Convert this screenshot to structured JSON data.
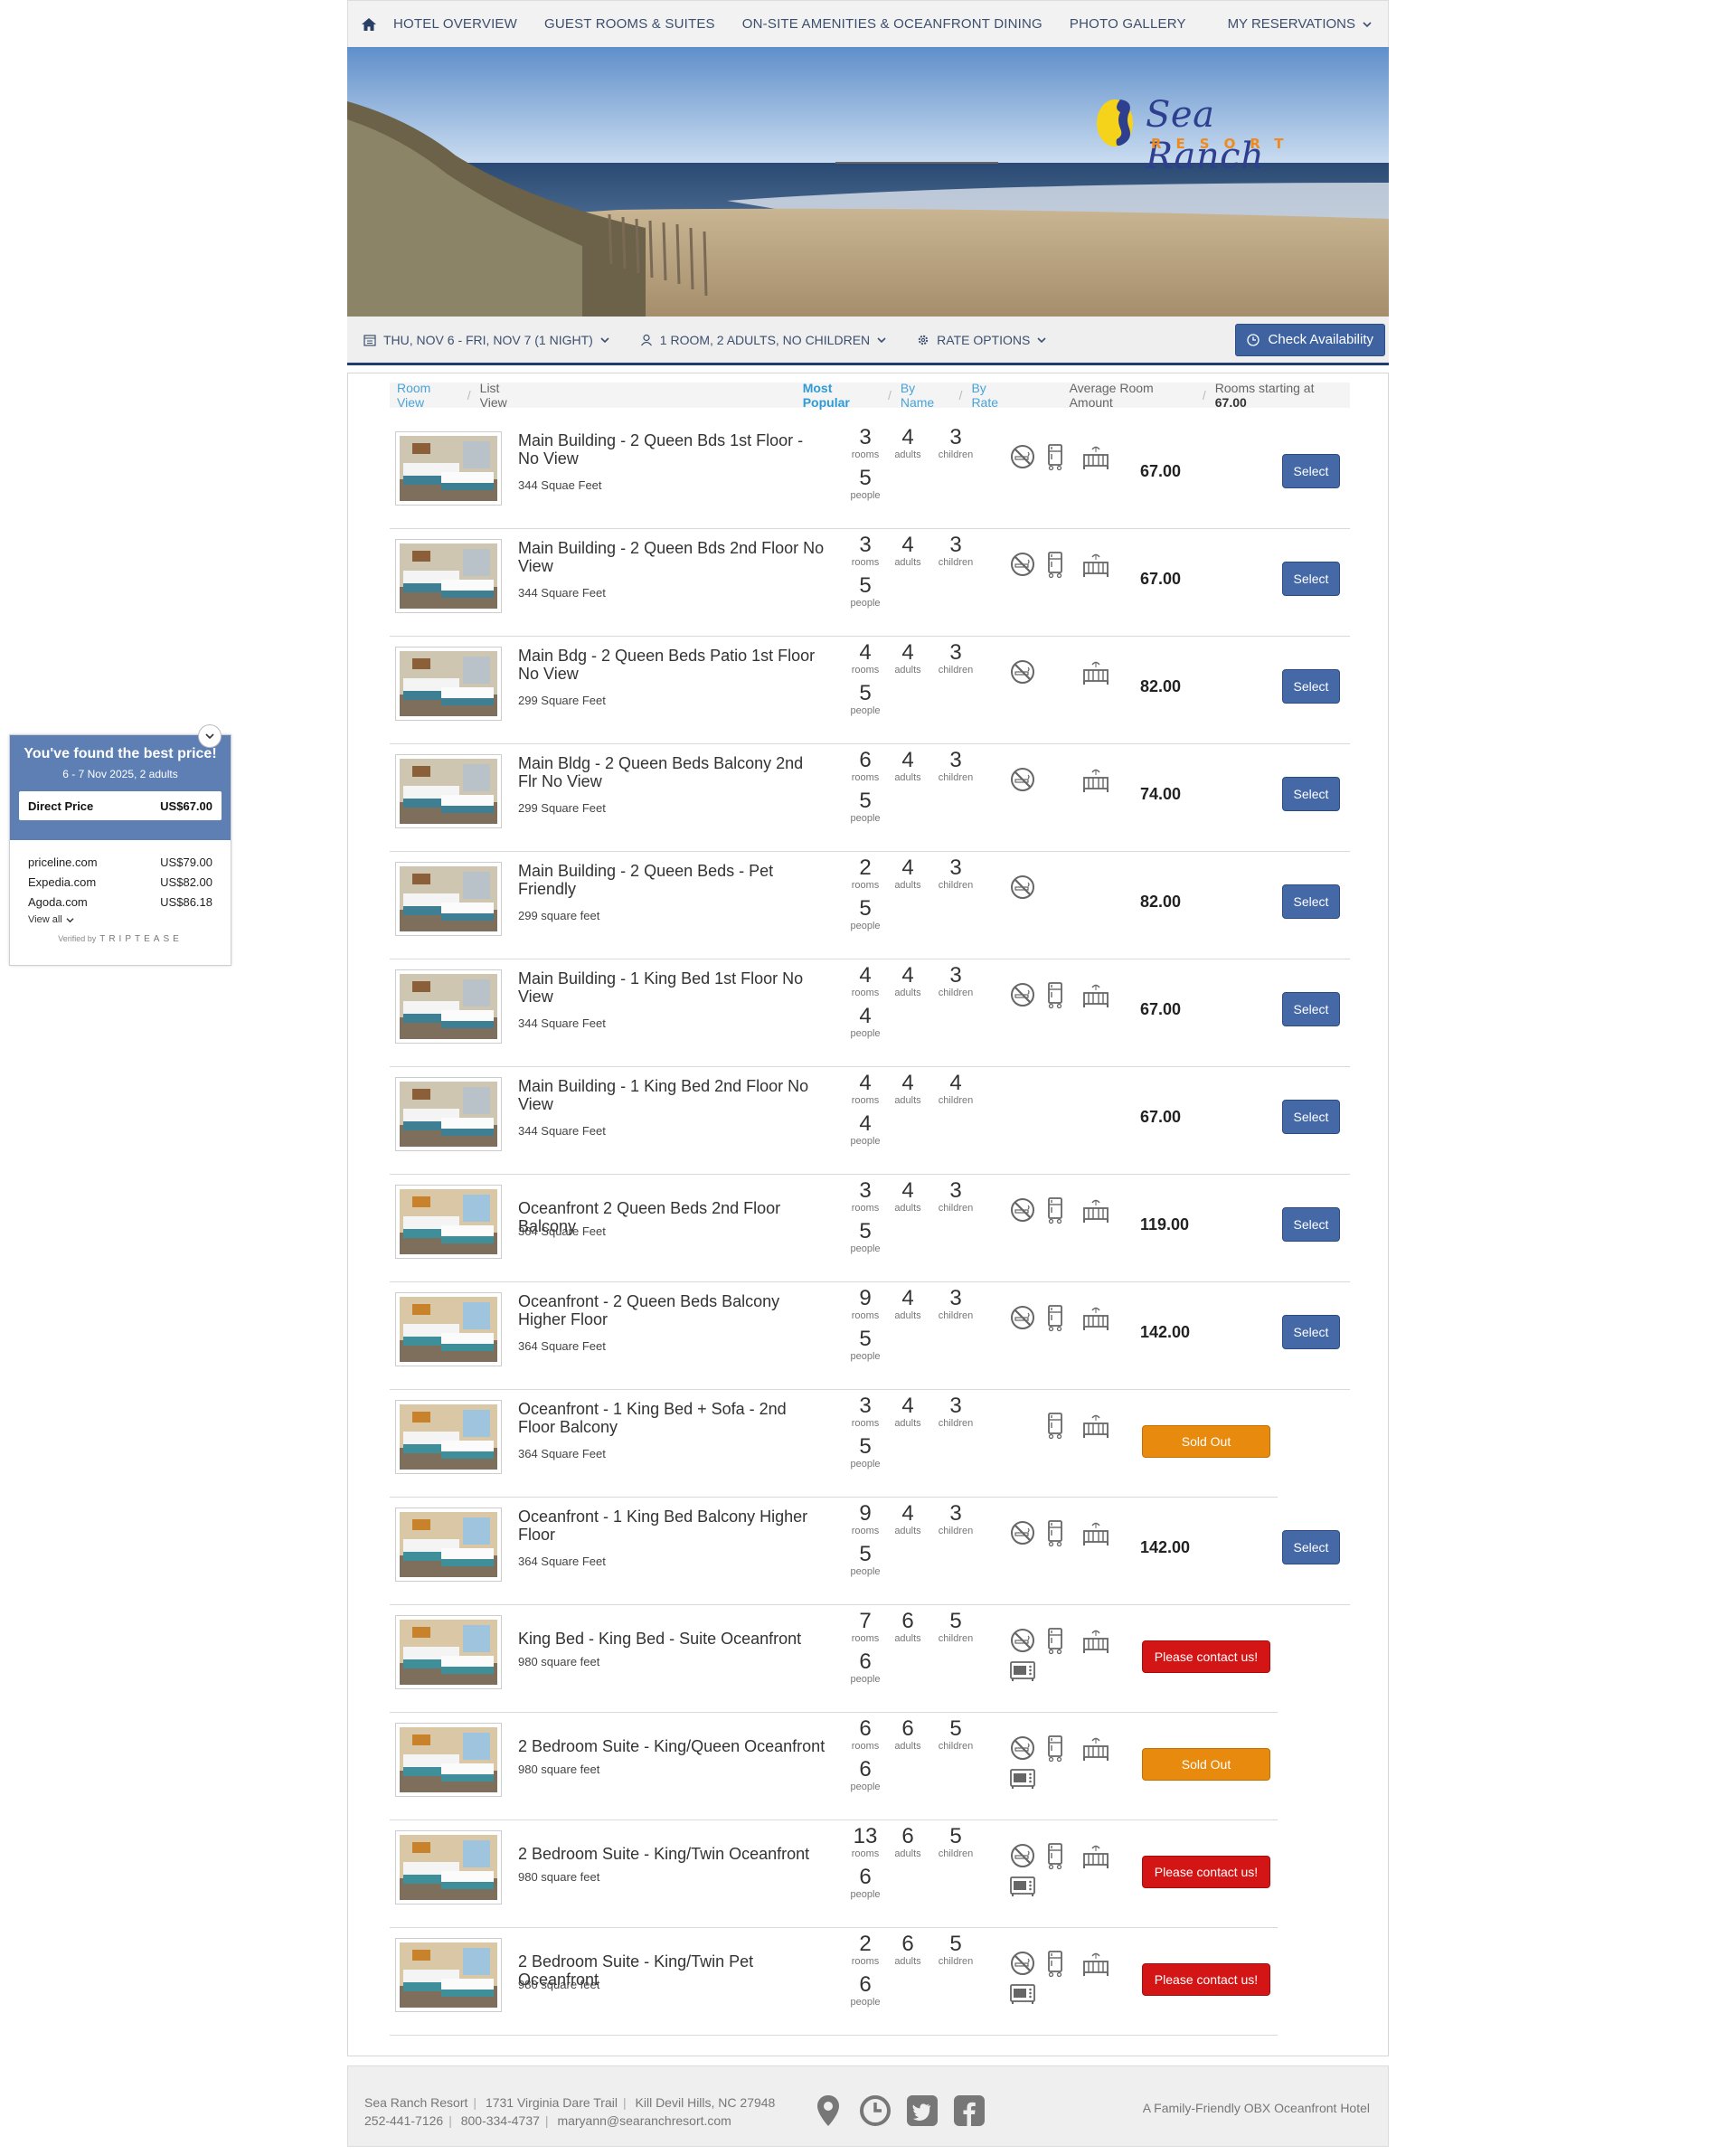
{
  "nav": {
    "items": [
      "HOTEL OVERVIEW",
      "GUEST ROOMS & SUITES",
      "ON-SITE AMENITIES & OCEANFRONT DINING",
      "PHOTO GALLERY"
    ],
    "reservations": "MY RESERVATIONS"
  },
  "logo": {
    "name": "Sea Ranch",
    "sub": "RESORT"
  },
  "search": {
    "dates": "THU, NOV 6 - FRI, NOV 7 (1 NIGHT)",
    "guests": "1 ROOM, 2 ADULTS, NO CHILDREN",
    "rate": "RATE OPTIONS",
    "check": "Check Availability"
  },
  "toolbar": {
    "room_view": "Room View",
    "list_view": "List View",
    "most_popular": "Most Popular",
    "by_name": "By Name",
    "by_rate": "By Rate",
    "avg": "Average Room Amount",
    "starting_label": "Rooms starting at",
    "starting_value": "67.00"
  },
  "labels": {
    "rooms": "rooms",
    "adults": "adults",
    "children": "children",
    "people": "people"
  },
  "rooms": [
    {
      "name": "Main Building - 2 Queen Bds 1st Floor - No View",
      "size": "344 Squae Feet",
      "rooms": "3",
      "adults": "4",
      "children": "3",
      "people": "5",
      "price": "67.00",
      "action": "Select",
      "icons": [
        "no-smoking-icon",
        "fridge-icon",
        "crib-icon"
      ]
    },
    {
      "name": "Main Building - 2 Queen Bds 2nd Floor No View",
      "size": "344 Square Feet",
      "rooms": "3",
      "adults": "4",
      "children": "3",
      "people": "5",
      "price": "67.00",
      "action": "Select",
      "icons": [
        "no-smoking-icon",
        "fridge-icon",
        "crib-icon"
      ]
    },
    {
      "name": "Main Bdg - 2 Queen Beds Patio 1st Floor No View",
      "size": "299 Square Feet",
      "rooms": "4",
      "adults": "4",
      "children": "3",
      "people": "5",
      "price": "82.00",
      "action": "Select",
      "icons": [
        "no-smoking-icon",
        "crib-icon"
      ]
    },
    {
      "name": "Main Bldg - 2 Queen Beds Balcony 2nd Flr No View",
      "size": "299 Square Feet",
      "rooms": "6",
      "adults": "4",
      "children": "3",
      "people": "5",
      "price": "74.00",
      "action": "Select",
      "icons": [
        "no-smoking-icon",
        "crib-icon"
      ]
    },
    {
      "name": "Main Building - 2 Queen Beds - Pet Friendly",
      "size": "299 square feet",
      "rooms": "2",
      "adults": "4",
      "children": "3",
      "people": "5",
      "price": "82.00",
      "action": "Select",
      "icons": [
        "no-smoking-icon"
      ]
    },
    {
      "name": "Main Building - 1 King Bed 1st Floor No View",
      "size": "344 Square Feet",
      "rooms": "4",
      "adults": "4",
      "children": "3",
      "people": "4",
      "price": "67.00",
      "action": "Select",
      "icons": [
        "no-smoking-icon",
        "fridge-icon",
        "crib-icon"
      ]
    },
    {
      "name": "Main Building - 1 King Bed 2nd Floor No View",
      "size": "344 Square Feet",
      "rooms": "4",
      "adults": "4",
      "children": "4",
      "people": "4",
      "price": "67.00",
      "action": "Select",
      "icons": []
    },
    {
      "name": "Oceanfront 2 Queen Beds 2nd Floor Balcony",
      "size": "364 Square Feet",
      "rooms": "3",
      "adults": "4",
      "children": "3",
      "people": "5",
      "price": "119.00",
      "action": "Select",
      "icons": [
        "no-smoking-icon",
        "fridge-icon",
        "crib-icon"
      ]
    },
    {
      "name": "Oceanfront - 2 Queen Beds Balcony Higher Floor",
      "size": "364 Square Feet",
      "rooms": "9",
      "adults": "4",
      "children": "3",
      "people": "5",
      "price": "142.00",
      "action": "Select",
      "icons": [
        "no-smoking-icon",
        "fridge-icon",
        "crib-icon"
      ]
    },
    {
      "name": "Oceanfront - 1 King Bed + Sofa - 2nd Floor Balcony",
      "size": "364 Square Feet",
      "rooms": "3",
      "adults": "4",
      "children": "3",
      "people": "5",
      "price": "",
      "action": "Sold Out",
      "icons": [
        "fridge-icon",
        "crib-icon"
      ]
    },
    {
      "name": "Oceanfront - 1 King Bed Balcony Higher Floor",
      "size": "364 Square Feet",
      "rooms": "9",
      "adults": "4",
      "children": "3",
      "people": "5",
      "price": "142.00",
      "action": "Select",
      "icons": [
        "no-smoking-icon",
        "fridge-icon",
        "crib-icon"
      ]
    },
    {
      "name": "King Bed - King Bed - Suite Oceanfront",
      "size": "980 square feet",
      "rooms": "7",
      "adults": "6",
      "children": "5",
      "people": "6",
      "price": "",
      "action": "Please contact us!",
      "icons": [
        "no-smoking-icon",
        "fridge-icon",
        "crib-icon",
        "microwave-icon"
      ]
    },
    {
      "name": "2 Bedroom Suite - King/Queen Oceanfront",
      "size": "980 square feet",
      "rooms": "6",
      "adults": "6",
      "children": "5",
      "people": "6",
      "price": "",
      "action": "Sold Out",
      "icons": [
        "no-smoking-icon",
        "fridge-icon",
        "crib-icon",
        "microwave-icon"
      ]
    },
    {
      "name": "2 Bedroom Suite - King/Twin Oceanfront",
      "size": "980 square feet",
      "rooms": "13",
      "adults": "6",
      "children": "5",
      "people": "6",
      "price": "",
      "action": "Please contact us!",
      "icons": [
        "no-smoking-icon",
        "fridge-icon",
        "crib-icon",
        "microwave-icon"
      ]
    },
    {
      "name": "2 Bedroom Suite - King/Twin Pet Oceanfront",
      "size": "980 square feet",
      "rooms": "2",
      "adults": "6",
      "children": "5",
      "people": "6",
      "price": "",
      "action": "Please contact us!",
      "icons": [
        "no-smoking-icon",
        "fridge-icon",
        "crib-icon",
        "microwave-icon"
      ]
    }
  ],
  "widget": {
    "title": "You've found the best price!",
    "dates": "6 - 7 Nov 2025, 2 adults",
    "direct_label": "Direct Price",
    "direct_price": "US$67.00",
    "others": [
      {
        "name": "priceline.com",
        "price": "US$79.00"
      },
      {
        "name": "Expedia.com",
        "price": "US$82.00"
      },
      {
        "name": "Agoda.com",
        "price": "US$86.18"
      }
    ],
    "view_all": "View all",
    "verified": "Verified by",
    "brand": "TRIPTEASE"
  },
  "footer": {
    "name": "Sea Ranch Resort",
    "address": "1731 Virginia Dare Trail",
    "city": "Kill Devil Hills, NC 27948",
    "phone1": "252-441-7126",
    "phone2": "800-334-4737",
    "email": "maryann@searanchresort.com",
    "tagline": "A Family-Friendly OBX Oceanfront Hotel"
  },
  "colors": {
    "accent": "#4469a6",
    "sold_out": "#e88a0e",
    "contact": "#d41515",
    "nav_text": "#3c4f6e",
    "widget_header": "#5d7fb4"
  }
}
